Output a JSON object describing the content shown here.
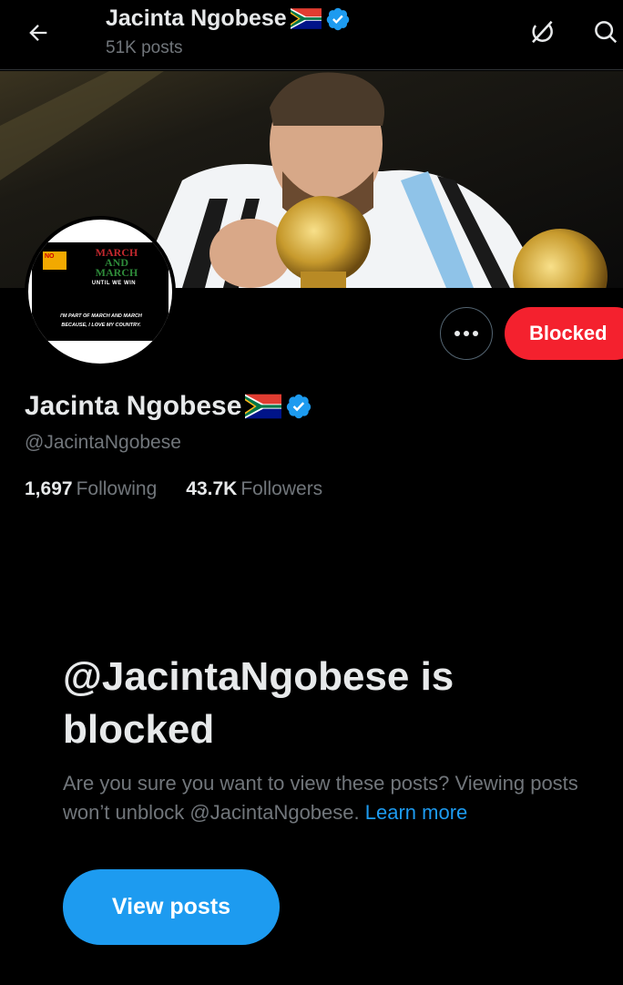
{
  "header": {
    "title": "Jacinta Ngobese",
    "post_count": "51K posts",
    "back_icon": "arrow-left-icon",
    "grok_icon": "grok-icon",
    "search_icon": "search-icon"
  },
  "banner": {
    "description_icon": "banner-image"
  },
  "avatar": {
    "badge_text": "NO",
    "march_line1": "MARCH",
    "march_line2": "AND",
    "march_line3": "MARCH",
    "until_text": "UNTIL WE WIN",
    "slogan_line1": "I'M PART OF MARCH AND MARCH",
    "slogan_line2": "BECAUSE, I LOVE MY COUNTRY."
  },
  "actions": {
    "more_icon": "more-horizontal-icon",
    "blocked_label": "Blocked"
  },
  "profile": {
    "name": "Jacinta Ngobese",
    "handle": "@JacintaNgobese",
    "following_count": "1,697",
    "following_label": "Following",
    "followers_count": "43.7K",
    "followers_label": "Followers"
  },
  "blocked_notice": {
    "title": "@JacintaNgobese is blocked",
    "description": "Are you sure you want to view these posts? Viewing posts won’t unblock @JacintaNgobese.",
    "learn_more": "Learn more",
    "view_posts_label": "View posts"
  },
  "colors": {
    "background": "#000000",
    "primary_text": "#e7e9ea",
    "secondary_text": "#71767b",
    "accent_blue": "#1d9bf0",
    "blocked_red": "#f4212e"
  }
}
